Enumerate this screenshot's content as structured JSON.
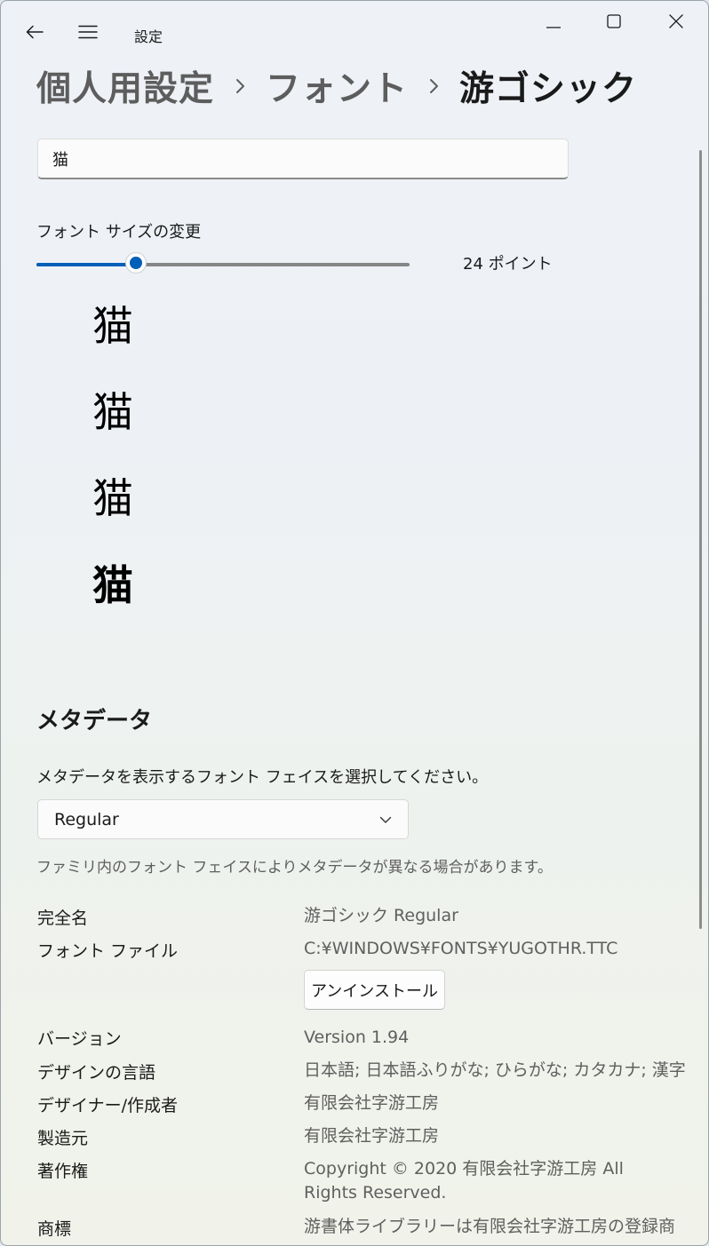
{
  "titlebar": {
    "app_title": "設定",
    "back_icon": "arrow-left",
    "menu_icon": "hamburger",
    "minimize_icon": "minimize",
    "maximize_icon": "maximize",
    "close_icon": "close"
  },
  "breadcrumb": [
    "個人用設定",
    "フォント",
    "游ゴシック"
  ],
  "search": {
    "value": "猫"
  },
  "font_size": {
    "label": "フォント サイズの変更",
    "value_text": "24 ポイント",
    "slider_fraction": 0.267
  },
  "samples": [
    "猫",
    "猫",
    "猫",
    "猫"
  ],
  "metadata": {
    "heading": "メタデータ",
    "description": "メタデータを表示するフォント フェイスを選択してください。",
    "face_selected": "Regular",
    "note": "ファミリ内のフォント フェイスによりメタデータが異なる場合があります。",
    "rows": [
      {
        "label": "完全名",
        "value": "游ゴシック Regular"
      },
      {
        "label": "フォント ファイル",
        "value": "C:¥WINDOWS¥FONTS¥YUGOTHR.TTC"
      },
      {
        "label": "バージョン",
        "value": "Version 1.94"
      },
      {
        "label": "デザインの言語",
        "value": "日本語; 日本語ふりがな; ひらがな; カタカナ; 漢字"
      },
      {
        "label": "デザイナー/作成者",
        "value": "有限会社字游工房"
      },
      {
        "label": "製造元",
        "value": "有限会社字游工房"
      },
      {
        "label": "著作権",
        "value": "Copyright © 2020 有限会社字游工房 All Rights Reserved."
      },
      {
        "label": "商標",
        "value": "游書体ライブラリーは有限会社字游工房の登録商"
      }
    ],
    "uninstall_label": "アンインストール"
  },
  "colors": {
    "accent": "#005fb8",
    "text": "#1a1a1a",
    "secondary_text": "#5f5f5f"
  }
}
